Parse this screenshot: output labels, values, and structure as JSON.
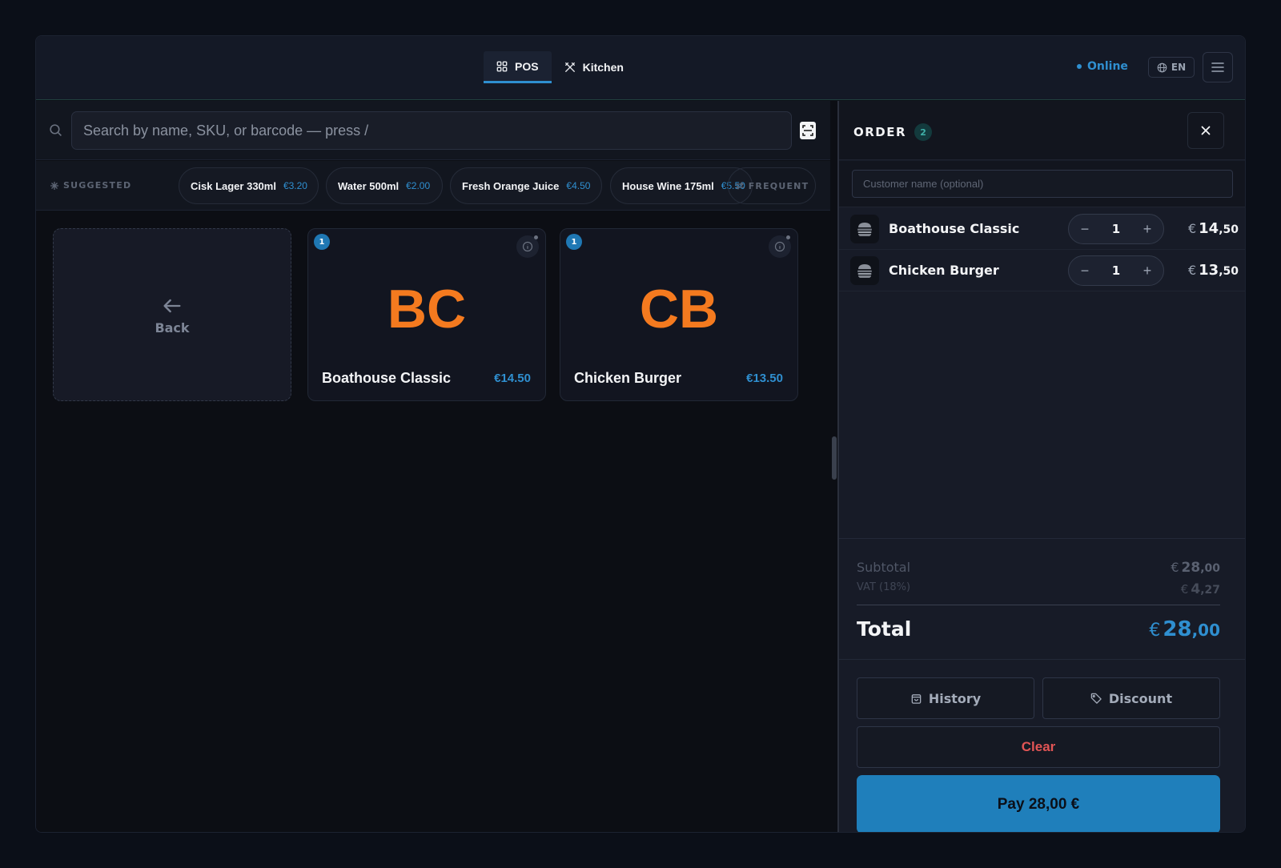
{
  "topbar": {
    "tabs": [
      {
        "label": "POS",
        "icon": "grid-icon",
        "active": true
      },
      {
        "label": "Kitchen",
        "icon": "utensils-icon",
        "active": false
      }
    ],
    "status": "Online",
    "language": "EN",
    "accent_color": "#2f8fd0"
  },
  "search": {
    "placeholder": "Search by name, SKU, or barcode — press /"
  },
  "suggested": {
    "label": "SUGGESTED",
    "items": [
      {
        "name": "Cisk Lager 330ml",
        "price": "€3.20"
      },
      {
        "name": "Water 500ml",
        "price": "€2.00"
      },
      {
        "name": "Fresh Orange Juice",
        "price": "€4.50"
      },
      {
        "name": "House Wine 175ml",
        "price": "€5.50"
      }
    ],
    "frequent_label": "FREQUENT"
  },
  "grid": {
    "back_label": "Back",
    "products": [
      {
        "initials": "BC",
        "name": "Boathouse Classic",
        "price": "€14.50",
        "in_cart": "1"
      },
      {
        "initials": "CB",
        "name": "Chicken Burger",
        "price": "€13.50",
        "in_cart": "1"
      }
    ],
    "initials_color": "#f47a1f"
  },
  "order": {
    "title": "ORDER",
    "count": "2",
    "customer_placeholder": "Customer name (optional)",
    "lines": [
      {
        "name": "Boathouse Classic",
        "qty": "1",
        "currency": "€",
        "int": "14",
        "dec": ",50"
      },
      {
        "name": "Chicken Burger",
        "qty": "1",
        "currency": "€",
        "int": "13",
        "dec": ",50"
      }
    ],
    "subtotal": {
      "label": "Subtotal",
      "currency": "€",
      "int": "28",
      "dec": ",00"
    },
    "vat": {
      "label": "VAT (18%)",
      "currency": "€",
      "int": "4",
      "dec": ",27"
    },
    "total": {
      "label": "Total",
      "currency": "€",
      "int": "28",
      "dec": ",00"
    },
    "history_label": "History",
    "discount_label": "Discount",
    "clear_label": "Clear",
    "pay_label": "Pay 28,00 €",
    "clear_color": "#e25555"
  }
}
